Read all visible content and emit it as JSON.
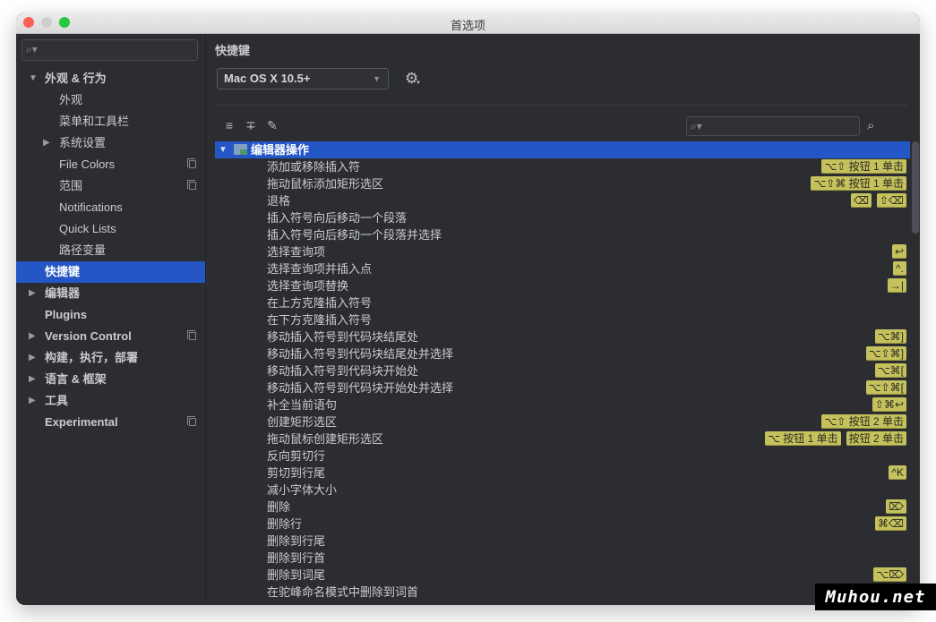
{
  "window": {
    "title": "首选项"
  },
  "sidebar": {
    "search_placeholder": "",
    "items": [
      {
        "label": "外观 & 行为",
        "level": 0,
        "expanded": true,
        "bold": true
      },
      {
        "label": "外观",
        "level": 1
      },
      {
        "label": "菜单和工具栏",
        "level": 1
      },
      {
        "label": "系统设置",
        "level": 1,
        "expandable": true
      },
      {
        "label": "File Colors",
        "level": 1,
        "project_icon": true
      },
      {
        "label": "范围",
        "level": 1,
        "project_icon": true
      },
      {
        "label": "Notifications",
        "level": 1
      },
      {
        "label": "Quick Lists",
        "level": 1
      },
      {
        "label": "路径变量",
        "level": 1
      },
      {
        "label": "快捷键",
        "level": 0,
        "selected": true
      },
      {
        "label": "编辑器",
        "level": 0,
        "expandable": true,
        "bold": true
      },
      {
        "label": "Plugins",
        "level": 0,
        "bold": true
      },
      {
        "label": "Version Control",
        "level": 0,
        "expandable": true,
        "bold": true,
        "project_icon": true
      },
      {
        "label": "构建，执行，部署",
        "level": 0,
        "expandable": true,
        "bold": true
      },
      {
        "label": "语言 & 框架",
        "level": 0,
        "expandable": true,
        "bold": true
      },
      {
        "label": "工具",
        "level": 0,
        "expandable": true,
        "bold": true
      },
      {
        "label": "Experimental",
        "level": 0,
        "bold": true,
        "project_icon": true
      }
    ]
  },
  "main": {
    "title": "快捷键",
    "keymap": {
      "selected": "Mac OS X 10.5+"
    },
    "icons": {
      "expand_all": "expand-all-icon",
      "collapse_all": "collapse-all-icon",
      "edit": "pencil-icon",
      "settings": "gear-icon",
      "find_by_shortcut": "find-shortcut-icon"
    },
    "search_placeholder": "",
    "group": {
      "label": "编辑器操作",
      "expanded": true
    },
    "actions": [
      {
        "label": "添加或移除插入符",
        "keys": [
          "⌥⇧ 按钮 1 单击"
        ]
      },
      {
        "label": "拖动鼠标添加矩形选区",
        "keys": [
          "⌥⇧⌘ 按钮 1 单击"
        ]
      },
      {
        "label": "退格",
        "keys": [
          "⌫",
          "⇧⌫"
        ]
      },
      {
        "label": "插入符号向后移动一个段落",
        "keys": []
      },
      {
        "label": "插入符号向后移动一个段落并选择",
        "keys": []
      },
      {
        "label": "选择查询项",
        "keys": [
          "↩"
        ]
      },
      {
        "label": "选择查询项并插入点",
        "keys": [
          "^."
        ]
      },
      {
        "label": "选择查询项替换",
        "keys": [
          "→|"
        ]
      },
      {
        "label": "在上方克隆插入符号",
        "keys": []
      },
      {
        "label": "在下方克隆插入符号",
        "keys": []
      },
      {
        "label": "移动插入符号到代码块结尾处",
        "keys": [
          "⌥⌘]"
        ]
      },
      {
        "label": "移动插入符号到代码块结尾处并选择",
        "keys": [
          "⌥⇧⌘]"
        ]
      },
      {
        "label": "移动插入符号到代码块开始处",
        "keys": [
          "⌥⌘["
        ]
      },
      {
        "label": "移动插入符号到代码块开始处并选择",
        "keys": [
          "⌥⇧⌘["
        ]
      },
      {
        "label": "补全当前语句",
        "keys": [
          "⇧⌘↩"
        ]
      },
      {
        "label": "创建矩形选区",
        "keys": [
          "⌥⇧ 按钮 2 单击"
        ]
      },
      {
        "label": "拖动鼠标创建矩形选区",
        "keys": [
          "⌥ 按钮 1 单击",
          "按钮 2 单击"
        ]
      },
      {
        "label": "反向剪切行",
        "keys": []
      },
      {
        "label": "剪切到行尾",
        "keys": [
          "^K"
        ]
      },
      {
        "label": "减小字体大小",
        "keys": []
      },
      {
        "label": "删除",
        "keys": [
          "⌦"
        ]
      },
      {
        "label": "删除行",
        "keys": [
          "⌘⌫"
        ]
      },
      {
        "label": "删除到行尾",
        "keys": []
      },
      {
        "label": "删除到行首",
        "keys": []
      },
      {
        "label": "删除到词尾",
        "keys": [
          "⌥⌦"
        ]
      },
      {
        "label": "在驼峰命名模式中删除到词首",
        "keys": []
      }
    ]
  },
  "watermark": "Muhou.net"
}
